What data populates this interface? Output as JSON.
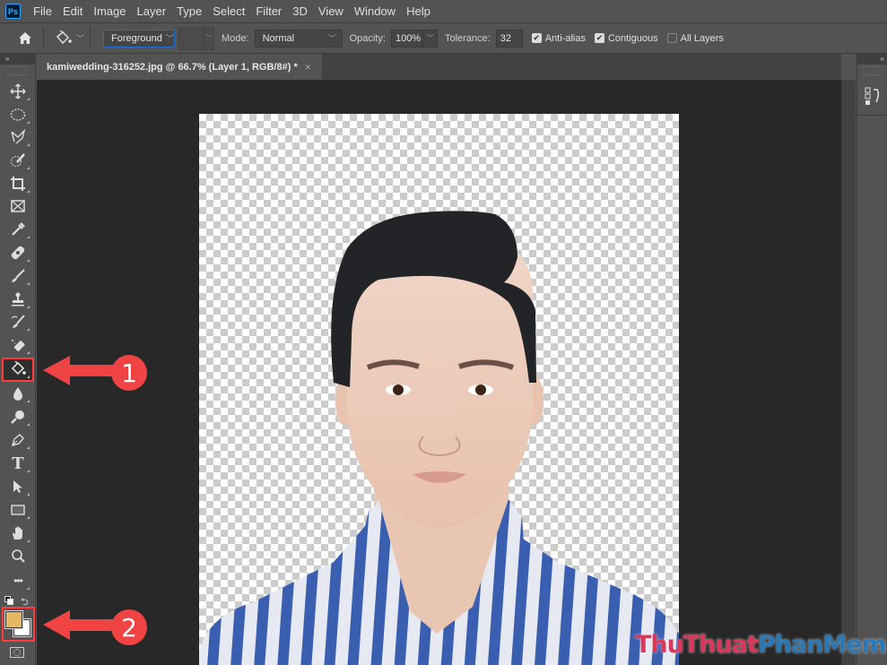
{
  "app": {
    "logo": "Ps"
  },
  "menu": [
    "File",
    "Edit",
    "Image",
    "Layer",
    "Type",
    "Select",
    "Filter",
    "3D",
    "View",
    "Window",
    "Help"
  ],
  "options": {
    "fill_source": "Foreground",
    "mode_label": "Mode:",
    "mode_value": "Normal",
    "opacity_label": "Opacity:",
    "opacity_value": "100%",
    "tolerance_label": "Tolerance:",
    "tolerance_value": "32",
    "anti_alias": {
      "label": "Anti-alias",
      "checked": true
    },
    "contiguous": {
      "label": "Contiguous",
      "checked": true
    },
    "all_layers": {
      "label": "All Layers",
      "checked": false
    }
  },
  "document": {
    "tab_title": "kamiwedding-316252.jpg @ 66.7% (Layer 1, RGB/8#) *",
    "close_glyph": "×"
  },
  "tools": [
    {
      "name": "move-tool",
      "icon": "move-icon"
    },
    {
      "name": "elliptical-marquee-tool",
      "icon": "ellipse-marquee-icon"
    },
    {
      "name": "polygonal-lasso-tool",
      "icon": "lasso-icon"
    },
    {
      "name": "quick-selection-tool",
      "icon": "quick-select-icon"
    },
    {
      "name": "crop-tool",
      "icon": "crop-icon"
    },
    {
      "name": "frame-tool",
      "icon": "frame-icon"
    },
    {
      "name": "eyedropper-tool",
      "icon": "eyedropper-icon"
    },
    {
      "name": "healing-brush-tool",
      "icon": "bandage-icon"
    },
    {
      "name": "brush-tool",
      "icon": "brush-icon"
    },
    {
      "name": "clone-stamp-tool",
      "icon": "stamp-icon"
    },
    {
      "name": "history-brush-tool",
      "icon": "history-brush-icon"
    },
    {
      "name": "eraser-tool",
      "icon": "eraser-icon"
    },
    {
      "name": "paint-bucket-tool",
      "icon": "paint-bucket-icon",
      "active": true
    },
    {
      "name": "blur-tool",
      "icon": "drop-icon"
    },
    {
      "name": "dodge-tool",
      "icon": "dodge-icon"
    },
    {
      "name": "pen-tool",
      "icon": "pen-icon"
    },
    {
      "name": "type-tool",
      "icon": "type-icon",
      "glyph": "T"
    },
    {
      "name": "path-selection-tool",
      "icon": "arrow-icon"
    },
    {
      "name": "rectangle-tool",
      "icon": "rectangle-icon"
    },
    {
      "name": "hand-tool",
      "icon": "hand-icon"
    },
    {
      "name": "zoom-tool",
      "icon": "magnifier-icon"
    },
    {
      "name": "edit-toolbar",
      "icon": "more-icon",
      "glyph": "•••"
    }
  ],
  "colors": {
    "foreground": "#e7b862",
    "background": "#ffffff",
    "highlight": "#ff3b3b",
    "annotation": "#f04444"
  },
  "annotations": [
    {
      "number": "1",
      "target": "paint-bucket-tool"
    },
    {
      "number": "2",
      "target": "foreground-background-colors"
    }
  ],
  "watermark": {
    "part1": "ThuThuat",
    "part2": "PhanMem.vn"
  }
}
